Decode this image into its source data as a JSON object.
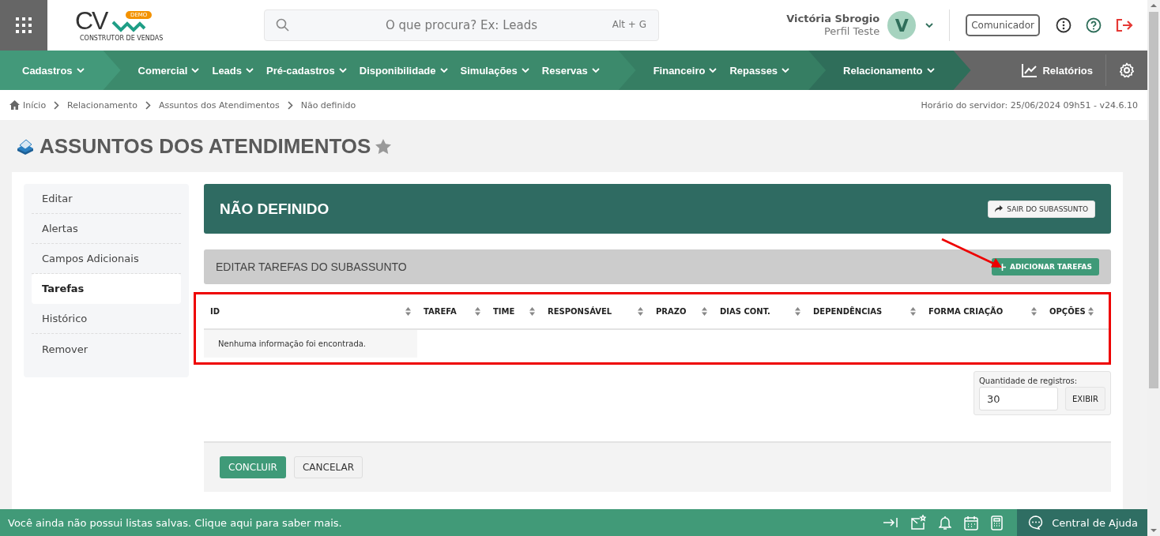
{
  "header": {
    "logo": {
      "letters": "CV",
      "badge": "DEMO",
      "tagline": "CONSTRUTOR DE VENDAS"
    },
    "search": {
      "placeholder": "O que procura? Ex: Leads",
      "shortcut": "Alt + G"
    },
    "user": {
      "name": "Victória Sbrogio",
      "profile": "Perfil Teste",
      "initial": "V"
    },
    "communicator": "Comunicador"
  },
  "nav": {
    "groups": [
      {
        "color": "#43997a",
        "items": [
          "Cadastros"
        ]
      },
      {
        "color": "#3c8a6c",
        "items": [
          "Comercial",
          "Leads",
          "Pré-cadastros",
          "Disponibilidade",
          "Simulações",
          "Reservas"
        ]
      },
      {
        "color": "#367e63",
        "items": [
          "Financeiro",
          "Repasses"
        ]
      },
      {
        "color": "#2f6e5a",
        "items": [
          "Relacionamento"
        ]
      }
    ],
    "reports": "Relatórios"
  },
  "breadcrumb": [
    "Início",
    "Relacionamento",
    "Assuntos dos Atendimentos",
    "Não definido"
  ],
  "server_time": "Horário do servidor: 25/06/2024 09h51 - v24.6.10",
  "page_title": "ASSUNTOS DOS ATENDIMENTOS",
  "sidebar": {
    "items": [
      {
        "label": "Editar",
        "selected": false
      },
      {
        "label": "Alertas",
        "selected": false
      },
      {
        "label": "Campos Adicionais",
        "selected": false
      },
      {
        "label": "Tarefas",
        "selected": true
      },
      {
        "label": "Histórico",
        "selected": false
      },
      {
        "label": "Remover",
        "selected": false
      }
    ]
  },
  "panel": {
    "title": "NÃO DEFINIDO",
    "exit_button": "SAIR DO SUBASSUNTO"
  },
  "tasks": {
    "title": "EDITAR TAREFAS DO SUBASSUNTO",
    "add_button": "ADICIONAR TAREFAS"
  },
  "table": {
    "columns": [
      "ID",
      "TAREFA",
      "TIME",
      "RESPONSÁVEL",
      "PRAZO",
      "DIAS CONT.",
      "DEPENDÊNCIAS",
      "FORMA CRIAÇÃO",
      "OPÇÕES"
    ],
    "empty_message": "Nenhuma informação foi encontrada."
  },
  "pagination": {
    "label": "Quantidade de registros:",
    "value": "30",
    "button": "EXIBIR"
  },
  "actions": [
    {
      "label": "CONCLUIR",
      "kind": "primary"
    },
    {
      "label": "CANCELAR",
      "kind": "secondary"
    }
  ],
  "status_bar": {
    "message": "Você ainda não possui listas salvas. Clique aqui para saber mais.",
    "help": "Central de Ajuda"
  }
}
